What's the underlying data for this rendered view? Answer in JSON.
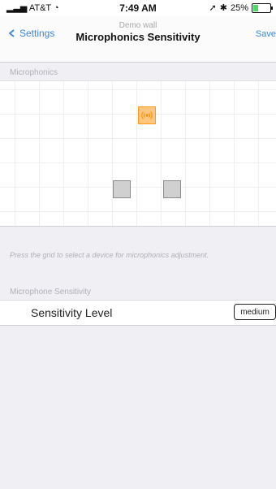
{
  "status_bar": {
    "carrier": "AT&T",
    "time": "7:49 AM",
    "battery": "25%",
    "battery_level": 0.25
  },
  "navbar": {
    "back_label": "Settings",
    "subtitle": "Demo wall",
    "title": "Microphonics Sensitivity",
    "save_label": "Save"
  },
  "microphonics": {
    "section_label": "Microphonics",
    "hint": "Press the grid to select a device for microphonics adjustment."
  },
  "sensitivity": {
    "section_label": "Microphone Sensitivity",
    "row_label": "Sensitivity Level",
    "value": "medium"
  },
  "colors": {
    "accent": "#3a87d9",
    "selected_device": "#ffc680",
    "device": "#d0d0d0"
  },
  "icons": {
    "selected_device": "microphone-broadcast-icon"
  }
}
